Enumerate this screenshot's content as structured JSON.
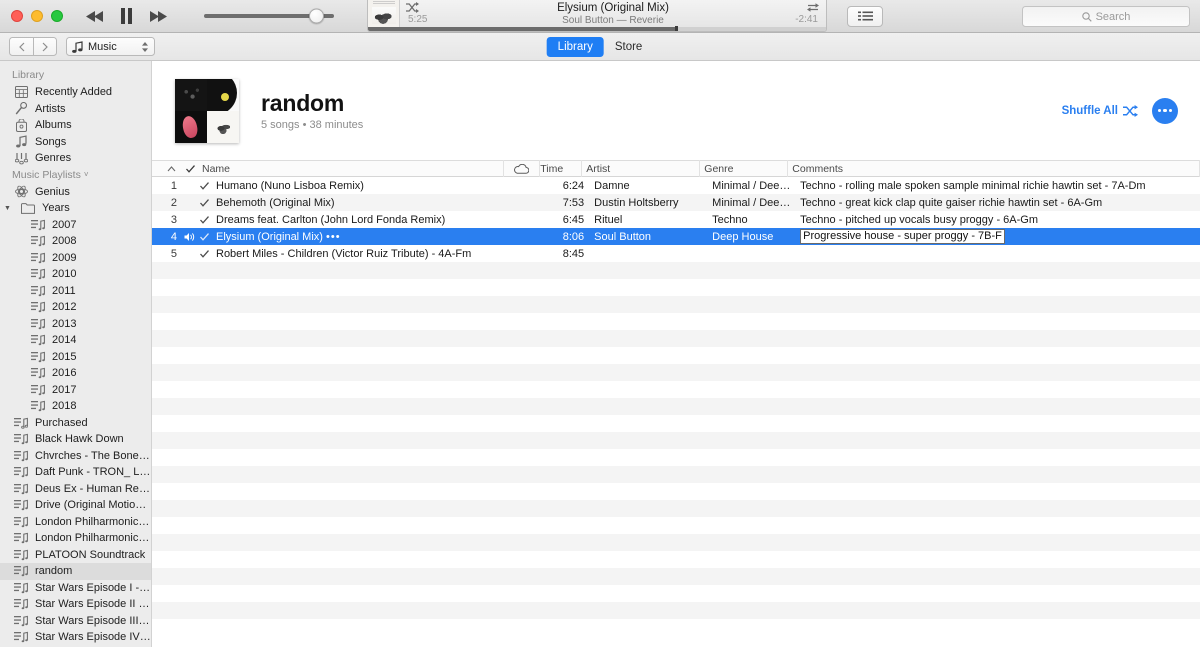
{
  "window": {
    "traffic_lights": [
      "close",
      "minimize",
      "zoom"
    ]
  },
  "player": {
    "rewind_icon": "rewind-icon",
    "pause_icon": "pause-icon",
    "fastforward_icon": "fastforward-icon",
    "volume_icon": "volume-slider",
    "volume_percent": 88,
    "shuffle_icon": "shuffle-icon",
    "repeat_icon": "repeat-icon",
    "now_playing_title": "Elysium (Original Mix)",
    "now_playing_subtitle": "Soul Button — Reverie",
    "elapsed": "5:25",
    "remaining": "-2:41",
    "progress_percent": 67,
    "artwork_alt": "album-artwork"
  },
  "toolbar": {
    "list_view_icon": "list-view-icon",
    "search_icon": "search-icon",
    "search_placeholder": "Search",
    "search_value": ""
  },
  "navbar": {
    "back_icon": "chevron-left-icon",
    "forward_icon": "chevron-right-icon",
    "media_kind_icon": "music-note-icon",
    "media_kind_label": "Music",
    "popup_chevron_icon": "chevron-updown-icon",
    "segments": [
      {
        "label": "Library",
        "active": true
      },
      {
        "label": "Store",
        "active": false
      }
    ]
  },
  "sidebar": {
    "sections": [
      {
        "header": "Library",
        "header_disclosure": false,
        "items": [
          {
            "label": "Recently Added",
            "icon": "recently-added-icon",
            "indent": false,
            "selected": false
          },
          {
            "label": "Artists",
            "icon": "microphone-icon",
            "indent": false,
            "selected": false
          },
          {
            "label": "Albums",
            "icon": "album-icon",
            "indent": false,
            "selected": false
          },
          {
            "label": "Songs",
            "icon": "music-note-icon",
            "indent": false,
            "selected": false
          },
          {
            "label": "Genres",
            "icon": "genres-icon",
            "indent": false,
            "selected": false
          }
        ]
      },
      {
        "header": "Music Playlists",
        "header_disclosure": true,
        "items": [
          {
            "label": "Genius",
            "icon": "genius-icon",
            "indent": false,
            "selected": false
          },
          {
            "label": "Years",
            "icon": "folder-icon",
            "indent": false,
            "selected": false,
            "disclosure": "open"
          },
          {
            "label": "2007",
            "icon": "playlist-icon",
            "indent": true,
            "selected": false
          },
          {
            "label": "2008",
            "icon": "playlist-icon",
            "indent": true,
            "selected": false
          },
          {
            "label": "2009",
            "icon": "playlist-icon",
            "indent": true,
            "selected": false
          },
          {
            "label": "2010",
            "icon": "playlist-icon",
            "indent": true,
            "selected": false
          },
          {
            "label": "2011",
            "icon": "playlist-icon",
            "indent": true,
            "selected": false
          },
          {
            "label": "2012",
            "icon": "playlist-icon",
            "indent": true,
            "selected": false
          },
          {
            "label": "2013",
            "icon": "playlist-icon",
            "indent": true,
            "selected": false
          },
          {
            "label": "2014",
            "icon": "playlist-icon",
            "indent": true,
            "selected": false
          },
          {
            "label": "2015",
            "icon": "playlist-icon",
            "indent": true,
            "selected": false
          },
          {
            "label": "2016",
            "icon": "playlist-icon",
            "indent": true,
            "selected": false
          },
          {
            "label": "2017",
            "icon": "playlist-icon",
            "indent": true,
            "selected": false
          },
          {
            "label": "2018",
            "icon": "playlist-icon",
            "indent": true,
            "selected": false
          },
          {
            "label": "Purchased",
            "icon": "purchased-playlist-icon",
            "indent": false,
            "selected": false
          },
          {
            "label": "Black Hawk Down",
            "icon": "playlist-icon",
            "indent": false,
            "selected": false
          },
          {
            "label": "Chvrches - The Bones Of…",
            "icon": "playlist-icon",
            "indent": false,
            "selected": false
          },
          {
            "label": "Daft Punk - TRON_ Legacy",
            "icon": "playlist-icon",
            "indent": false,
            "selected": false
          },
          {
            "label": "Deus Ex - Human Revoluti…",
            "icon": "playlist-icon",
            "indent": false,
            "selected": false
          },
          {
            "label": "Drive (Original Motion Pict…",
            "icon": "playlist-icon",
            "indent": false,
            "selected": false
          },
          {
            "label": "London Philharmonic Orch…",
            "icon": "playlist-icon",
            "indent": false,
            "selected": false
          },
          {
            "label": "London Philharmonic Orch…",
            "icon": "playlist-icon",
            "indent": false,
            "selected": false
          },
          {
            "label": "PLATOON Soundtrack",
            "icon": "playlist-icon",
            "indent": false,
            "selected": false
          },
          {
            "label": "random",
            "icon": "playlist-icon",
            "indent": false,
            "selected": true
          },
          {
            "label": "Star Wars Episode I - The…",
            "icon": "playlist-icon",
            "indent": false,
            "selected": false
          },
          {
            "label": "Star Wars Episode II - Atta…",
            "icon": "playlist-icon",
            "indent": false,
            "selected": false
          },
          {
            "label": "Star Wars Episode III - Rev…",
            "icon": "playlist-icon",
            "indent": false,
            "selected": false
          },
          {
            "label": "Star Wars Episode IV - A N…",
            "icon": "playlist-icon",
            "indent": false,
            "selected": false
          }
        ]
      }
    ]
  },
  "playlist": {
    "title": "random",
    "subtitle": "5 songs • 38 minutes",
    "artwork_alt": "playlist-artwork-collage",
    "shuffle_all_label": "Shuffle All",
    "shuffle_icon": "shuffle-icon",
    "more_button_icon": "ellipsis-icon",
    "accent_color": "#2a7ff0"
  },
  "table": {
    "sort_indicator_icon": "sort-ascending-icon",
    "check_header_icon": "checkmark-icon",
    "cloud_header_icon": "cloud-icon",
    "columns": [
      "",
      "",
      "Name",
      "",
      "Time",
      "Artist",
      "Genre",
      "Comments"
    ],
    "headers": {
      "name": "Name",
      "time": "Time",
      "artist": "Artist",
      "genre": "Genre",
      "comments": "Comments"
    },
    "rows": [
      {
        "num": "1",
        "checked": true,
        "playing": false,
        "name": "Humano (Nuno Lisboa Remix)",
        "time": "6:24",
        "artist": "Damne",
        "genre": "Minimal / Deep T…",
        "comments": "Techno - rolling male spoken sample minimal richie hawtin set - 7A-Dm",
        "selected": false,
        "editing": false
      },
      {
        "num": "2",
        "checked": true,
        "playing": false,
        "name": "Behemoth (Original Mix)",
        "time": "7:53",
        "artist": "Dustin Holtsberry",
        "genre": "Minimal / Deep T…",
        "comments": "Techno - great kick clap quite gaiser richie hawtin set - 6A-Gm",
        "selected": false,
        "editing": false
      },
      {
        "num": "3",
        "checked": true,
        "playing": false,
        "name": "Dreams feat. Carlton (John Lord Fonda Remix)",
        "time": "6:45",
        "artist": "Rituel",
        "genre": "Techno",
        "comments": "Techno - pitched up vocals busy proggy - 6A-Gm",
        "selected": false,
        "editing": false
      },
      {
        "num": "4",
        "checked": true,
        "playing": true,
        "name": "Elysium (Original Mix)",
        "name_suffix": "•••",
        "time": "8:06",
        "artist": "Soul Button",
        "genre": "Deep House",
        "comments": "Progressive house - super proggy - 7B-F",
        "selected": true,
        "editing": true
      },
      {
        "num": "5",
        "checked": true,
        "playing": false,
        "name": "Robert Miles - Children (Victor Ruiz Tribute) - 4A-Fm",
        "time": "8:45",
        "artist": "",
        "genre": "",
        "comments": "",
        "selected": false,
        "editing": false
      }
    ],
    "empty_row_count": 22
  }
}
